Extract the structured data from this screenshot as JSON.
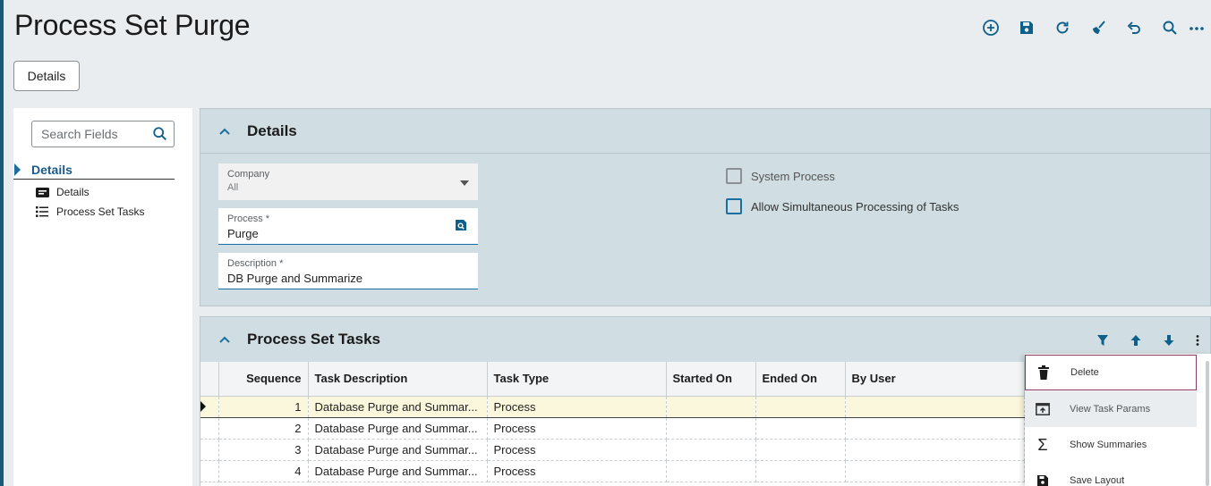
{
  "page": {
    "title": "Process Set Purge"
  },
  "toolbar": {
    "buttons": [
      {
        "name": "add-icon"
      },
      {
        "name": "save-icon"
      },
      {
        "name": "refresh-icon"
      },
      {
        "name": "clear-icon"
      },
      {
        "name": "undo-icon"
      },
      {
        "name": "search-icon"
      },
      {
        "name": "more-icon"
      }
    ]
  },
  "tabs": {
    "details_label": "Details"
  },
  "sidebar": {
    "search_placeholder": "Search Fields",
    "section_label": "Details",
    "items": [
      {
        "label": "Details",
        "icon": "card-icon"
      },
      {
        "label": "Process Set Tasks",
        "icon": "list-icon"
      }
    ]
  },
  "details": {
    "title": "Details",
    "company": {
      "label": "Company",
      "value": "All"
    },
    "process": {
      "label": "Process *",
      "value": "Purge"
    },
    "description": {
      "label": "Description *",
      "value": "DB Purge and Summarize"
    },
    "system_process": {
      "label": "System Process",
      "checked": false
    },
    "allow_simultaneous": {
      "label": "Allow Simultaneous Processing of Tasks",
      "checked": false
    }
  },
  "tasks": {
    "title": "Process Set Tasks",
    "columns": [
      "Sequence",
      "Task Description",
      "Task Type",
      "Started On",
      "Ended On",
      "By User"
    ],
    "rows": [
      {
        "sequence": "1",
        "description": "Database Purge and Summar...",
        "type": "Process",
        "started": "",
        "ended": "",
        "user": ""
      },
      {
        "sequence": "2",
        "description": "Database Purge and Summar...",
        "type": "Process",
        "started": "",
        "ended": "",
        "user": ""
      },
      {
        "sequence": "3",
        "description": "Database Purge and Summar...",
        "type": "Process",
        "started": "",
        "ended": "",
        "user": ""
      },
      {
        "sequence": "4",
        "description": "Database Purge and Summar...",
        "type": "Process",
        "started": "",
        "ended": "",
        "user": ""
      }
    ]
  },
  "context_menu": {
    "items": [
      {
        "label": "Delete",
        "icon": "trash-icon"
      },
      {
        "label": "View Task Params",
        "icon": "view-params-icon"
      },
      {
        "label": "Show Summaries",
        "icon": "sigma-icon"
      },
      {
        "label": "Save Layout",
        "icon": "save-layout-icon"
      }
    ]
  },
  "colors": {
    "accent": "#0e5f8a",
    "rail": "#1a5b7a",
    "panel": "#d0dde2",
    "selected_row": "#fbf7dc"
  }
}
